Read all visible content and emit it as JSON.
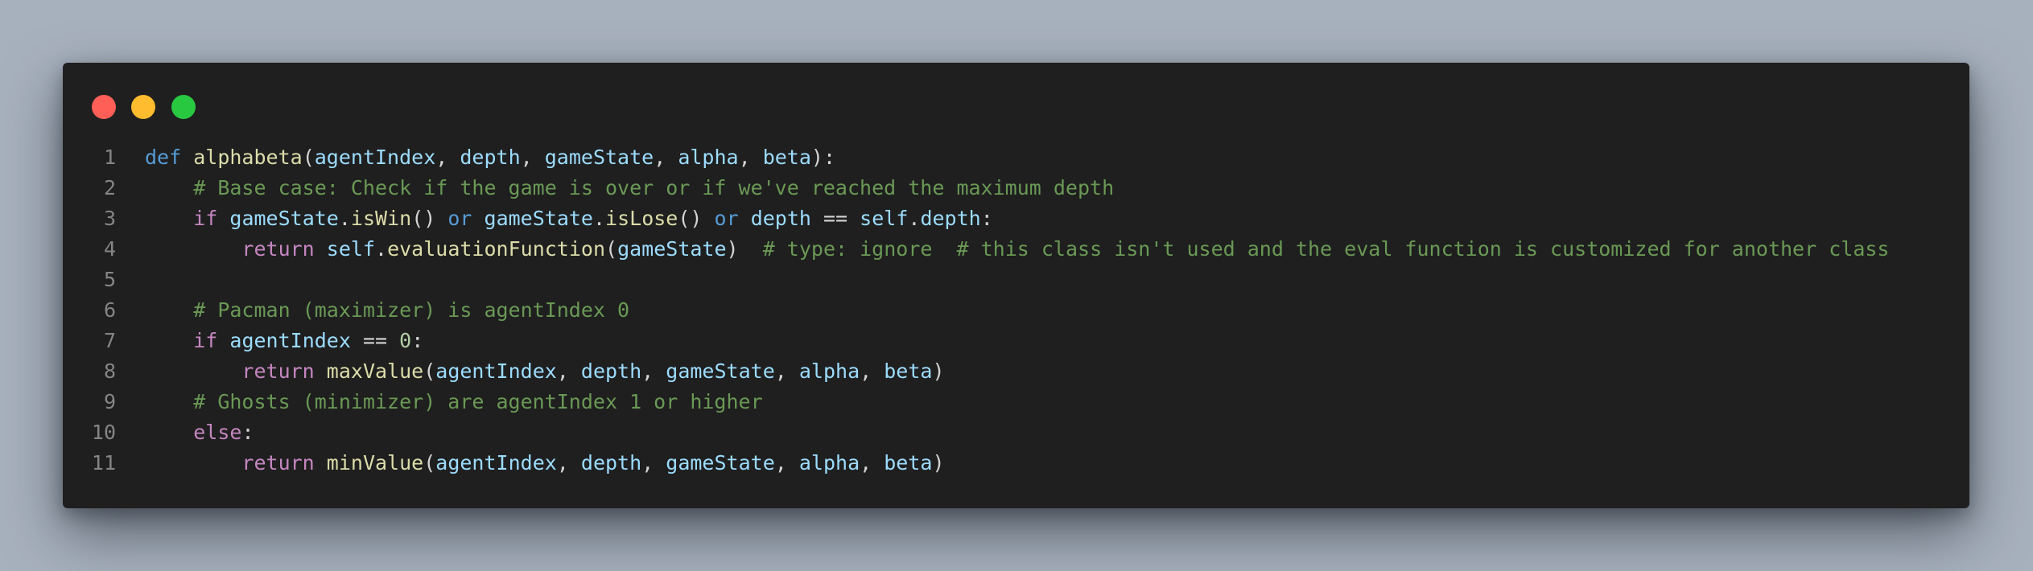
{
  "window": {
    "buttons": [
      {
        "name": "close",
        "color": "#ff5f57"
      },
      {
        "name": "minimize",
        "color": "#febc2e"
      },
      {
        "name": "maximize",
        "color": "#28c840"
      }
    ]
  },
  "code": {
    "language": "python",
    "lines": [
      {
        "n": "1",
        "tokens": [
          [
            "kw",
            "def"
          ],
          [
            "pl",
            " "
          ],
          [
            "fn",
            "alphabeta"
          ],
          [
            "pl",
            "("
          ],
          [
            "var",
            "agentIndex"
          ],
          [
            "pl",
            ", "
          ],
          [
            "var",
            "depth"
          ],
          [
            "pl",
            ", "
          ],
          [
            "var",
            "gameState"
          ],
          [
            "pl",
            ", "
          ],
          [
            "var",
            "alpha"
          ],
          [
            "pl",
            ", "
          ],
          [
            "var",
            "beta"
          ],
          [
            "pl",
            "):"
          ]
        ]
      },
      {
        "n": "2",
        "tokens": [
          [
            "pl",
            "    "
          ],
          [
            "cm",
            "# Base case: Check if the game is over or if we've reached the maximum depth"
          ]
        ]
      },
      {
        "n": "3",
        "tokens": [
          [
            "pl",
            "    "
          ],
          [
            "ctl",
            "if"
          ],
          [
            "pl",
            " "
          ],
          [
            "var",
            "gameState"
          ],
          [
            "pl",
            "."
          ],
          [
            "fn",
            "isWin"
          ],
          [
            "pl",
            "() "
          ],
          [
            "kw",
            "or"
          ],
          [
            "pl",
            " "
          ],
          [
            "var",
            "gameState"
          ],
          [
            "pl",
            "."
          ],
          [
            "fn",
            "isLose"
          ],
          [
            "pl",
            "() "
          ],
          [
            "kw",
            "or"
          ],
          [
            "pl",
            " "
          ],
          [
            "var",
            "depth"
          ],
          [
            "pl",
            " == "
          ],
          [
            "var",
            "self"
          ],
          [
            "pl",
            "."
          ],
          [
            "var",
            "depth"
          ],
          [
            "pl",
            ":"
          ]
        ]
      },
      {
        "n": "4",
        "tokens": [
          [
            "pl",
            "        "
          ],
          [
            "ctl",
            "return"
          ],
          [
            "pl",
            " "
          ],
          [
            "var",
            "self"
          ],
          [
            "pl",
            "."
          ],
          [
            "fn",
            "evaluationFunction"
          ],
          [
            "pl",
            "("
          ],
          [
            "var",
            "gameState"
          ],
          [
            "pl",
            ")  "
          ],
          [
            "cm",
            "# type: ignore  # this class isn't used and the eval function is customized for another class"
          ]
        ]
      },
      {
        "n": "5",
        "tokens": []
      },
      {
        "n": "6",
        "tokens": [
          [
            "pl",
            "    "
          ],
          [
            "cm",
            "# Pacman (maximizer) is agentIndex 0"
          ]
        ]
      },
      {
        "n": "7",
        "tokens": [
          [
            "pl",
            "    "
          ],
          [
            "ctl",
            "if"
          ],
          [
            "pl",
            " "
          ],
          [
            "var",
            "agentIndex"
          ],
          [
            "pl",
            " == "
          ],
          [
            "num",
            "0"
          ],
          [
            "pl",
            ":"
          ]
        ]
      },
      {
        "n": "8",
        "tokens": [
          [
            "pl",
            "        "
          ],
          [
            "ctl",
            "return"
          ],
          [
            "pl",
            " "
          ],
          [
            "fn",
            "maxValue"
          ],
          [
            "pl",
            "("
          ],
          [
            "var",
            "agentIndex"
          ],
          [
            "pl",
            ", "
          ],
          [
            "var",
            "depth"
          ],
          [
            "pl",
            ", "
          ],
          [
            "var",
            "gameState"
          ],
          [
            "pl",
            ", "
          ],
          [
            "var",
            "alpha"
          ],
          [
            "pl",
            ", "
          ],
          [
            "var",
            "beta"
          ],
          [
            "pl",
            ")"
          ]
        ]
      },
      {
        "n": "9",
        "tokens": [
          [
            "pl",
            "    "
          ],
          [
            "cm",
            "# Ghosts (minimizer) are agentIndex 1 or higher"
          ]
        ]
      },
      {
        "n": "10",
        "tokens": [
          [
            "pl",
            "    "
          ],
          [
            "ctl",
            "else"
          ],
          [
            "pl",
            ":"
          ]
        ]
      },
      {
        "n": "11",
        "tokens": [
          [
            "pl",
            "        "
          ],
          [
            "ctl",
            "return"
          ],
          [
            "pl",
            " "
          ],
          [
            "fn",
            "minValue"
          ],
          [
            "pl",
            "("
          ],
          [
            "var",
            "agentIndex"
          ],
          [
            "pl",
            ", "
          ],
          [
            "var",
            "depth"
          ],
          [
            "pl",
            ", "
          ],
          [
            "var",
            "gameState"
          ],
          [
            "pl",
            ", "
          ],
          [
            "var",
            "alpha"
          ],
          [
            "pl",
            ", "
          ],
          [
            "var",
            "beta"
          ],
          [
            "pl",
            ")"
          ]
        ]
      }
    ]
  }
}
